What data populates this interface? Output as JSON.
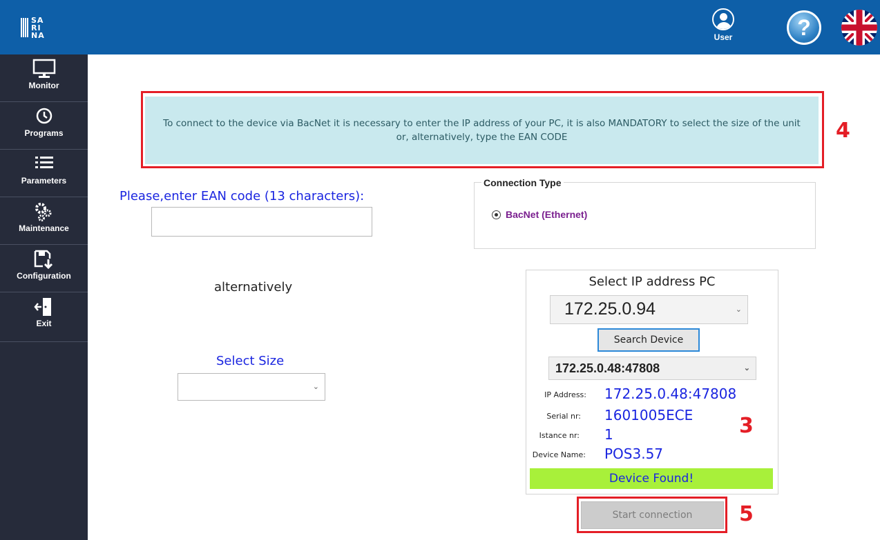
{
  "header": {
    "logo_text": "SA\nRI\nNA",
    "user_label": "User",
    "help_label": "?",
    "icons": {
      "user": "user-icon",
      "help": "help-icon",
      "language": "uk-flag-icon"
    }
  },
  "sidebar": {
    "items": [
      {
        "label": "Monitor",
        "icon": "monitor-icon"
      },
      {
        "label": "Programs",
        "icon": "clock-icon"
      },
      {
        "label": "Parameters",
        "icon": "list-icon"
      },
      {
        "label": "Maintenance",
        "icon": "gears-icon"
      },
      {
        "label": "Configuration",
        "icon": "save-download-icon"
      },
      {
        "label": "Exit",
        "icon": "exit-door-icon"
      }
    ]
  },
  "banner": {
    "text": "To connect to the device via BacNet it is necessary to enter the IP address of your PC, it is also MANDATORY to select the size of the unit or, alternatively, type the EAN CODE"
  },
  "markers": {
    "banner": "4",
    "device": "3",
    "start": "5"
  },
  "ean": {
    "label": "Please,enter EAN code (13 characters):",
    "value": ""
  },
  "alternatively": "alternatively",
  "size": {
    "label": "Select Size",
    "selected": ""
  },
  "connection": {
    "title": "Connection Type",
    "option": "BacNet (Ethernet)"
  },
  "ip_panel": {
    "title": "Select IP address PC",
    "pc_ip": "172.25.0.94",
    "search_button": "Search Device",
    "device_select": "172.25.0.48:47808",
    "ip_label": "IP Address:",
    "ip_value": "172.25.0.48:47808",
    "serial_label": "Serial nr:",
    "serial_value": "1601005ECE",
    "instance_label": "Istance nr:",
    "instance_value": "1",
    "name_label": "Device Name:",
    "name_value": "POS3.57",
    "status": "Device Found!"
  },
  "start_button": "Start connection",
  "colors": {
    "header_bg": "#0E5FA8",
    "sidebar_bg": "#262B3A",
    "banner_bg": "#C9E9EE",
    "highlight_red": "#E41E26",
    "value_blue": "#1A25E0",
    "found_green": "#A8F03A"
  }
}
